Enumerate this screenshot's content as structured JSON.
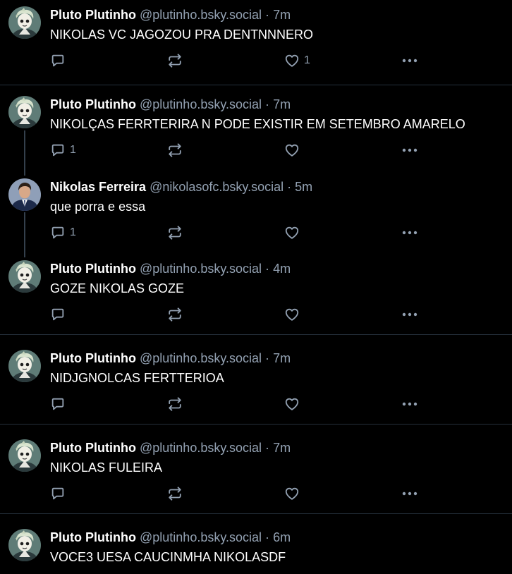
{
  "colors": {
    "background": "#000000",
    "divider": "#25303b",
    "muted_text": "#93a1b2",
    "primary_text": "#ffffff"
  },
  "icons": {
    "reply": "reply-icon",
    "repost": "repost-icon",
    "like": "heart-icon",
    "more": "more-icon"
  },
  "posts": [
    {
      "author": "Pluto Plutinho",
      "handle": "@plutinho.bsky.social",
      "separator": "·",
      "time": "7m",
      "text": "NIKOLAS VC JAGOZOU PRA DENTNNNERO",
      "reply_count": "",
      "like_count": "1",
      "avatar": "pluto"
    },
    {
      "author": "Pluto Plutinho",
      "handle": "@plutinho.bsky.social",
      "separator": "·",
      "time": "7m",
      "text": "NIKOLÇAS FERRTERIRA N PODE EXISTIR EM SETEMBRO AMARELO",
      "reply_count": "1",
      "like_count": "",
      "avatar": "pluto"
    },
    {
      "author": "Nikolas Ferreira",
      "handle": "@nikolasofc.bsky.social",
      "separator": "·",
      "time": "5m",
      "text": "que porra e essa",
      "reply_count": "1",
      "like_count": "",
      "avatar": "nikolas"
    },
    {
      "author": "Pluto Plutinho",
      "handle": "@plutinho.bsky.social",
      "separator": "·",
      "time": "4m",
      "text": "GOZE NIKOLAS GOZE",
      "reply_count": "",
      "like_count": "",
      "avatar": "pluto"
    },
    {
      "author": "Pluto Plutinho",
      "handle": "@plutinho.bsky.social",
      "separator": "·",
      "time": "7m",
      "text": "NIDJGNOLCAS FERTTERIOA",
      "reply_count": "",
      "like_count": "",
      "avatar": "pluto"
    },
    {
      "author": "Pluto Plutinho",
      "handle": "@plutinho.bsky.social",
      "separator": "·",
      "time": "7m",
      "text": "NIKOLAS FULEIRA",
      "reply_count": "",
      "like_count": "",
      "avatar": "pluto"
    },
    {
      "author": "Pluto Plutinho",
      "handle": "@plutinho.bsky.social",
      "separator": "·",
      "time": "6m",
      "text": "VOCE3 UESA CAUCINMHA NIKOLASDF",
      "reply_count": "",
      "like_count": "",
      "avatar": "pluto"
    }
  ]
}
